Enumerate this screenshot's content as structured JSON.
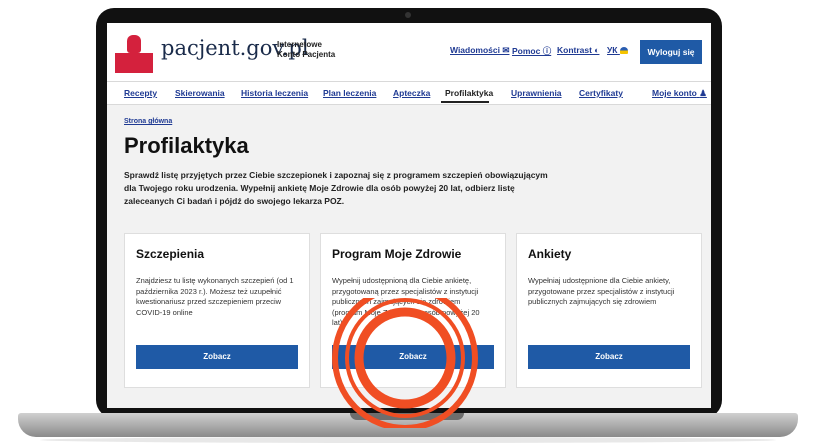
{
  "header": {
    "brand": "pacjent.gov.pl",
    "subtitle_line1": "Internetowe",
    "subtitle_line2": "Konto Pacjenta",
    "nav": [
      {
        "label": "Wiadomości ✉"
      },
      {
        "label": "Pomoc ⓘ"
      },
      {
        "label": "Kontrast ◐"
      },
      {
        "label": "УК"
      }
    ],
    "logout_label": "Wyloguj się"
  },
  "tabs": [
    {
      "label": "Recepty"
    },
    {
      "label": "Skierowania"
    },
    {
      "label": "Historia leczenia"
    },
    {
      "label": "Plan leczenia"
    },
    {
      "label": "Apteczka"
    },
    {
      "label": "Profilaktyka"
    },
    {
      "label": "Uprawnienia"
    },
    {
      "label": "Certyfikaty"
    },
    {
      "label": "Moje konto"
    }
  ],
  "active_tab": "Profilaktyka",
  "main": {
    "breadcrumb": "Strona główna",
    "title": "Profilaktyka",
    "intro": "Sprawdź listę przyjętych przez Ciebie szczepionek i zapoznaj się z programem szczepień obowiązującym dla Twojego roku urodzenia. Wypełnij ankietę Moje Zdrowie dla osób powyżej 20 lat, odbierz listę zaleceanych Ci badań i pójdź do swojego lekarza POZ.",
    "cards": [
      {
        "title": "Szczepienia",
        "body": "Znajdziesz tu listę wykonanych szczepień (od 1 października 2023 r.). Możesz też uzupełnić kwestionariusz przed szczepieniem przeciw COVID-19 online",
        "button": "Zobacz"
      },
      {
        "title": "Program Moje Zdrowie",
        "body": "Wypełnij udostępnioną dla Ciebie ankietę, przygotowaną przez specjalistów z instytucji publicznych zajmujących się zdrowiem (program Moje Zdrowie dla osób powyżej 20 lat)",
        "button": "Zobacz"
      },
      {
        "title": "Ankiety",
        "body": "Wypełniaj udostępnione dla Ciebie ankiety, przygotowane przez specjalistów z instytucji publicznych zajmujących się zdrowiem",
        "button": "Zobacz"
      }
    ]
  },
  "colors": {
    "primary": "#1f5aa6",
    "link": "#1f3a93",
    "emblem_red": "#d4213d",
    "highlight": "#f04e23"
  }
}
